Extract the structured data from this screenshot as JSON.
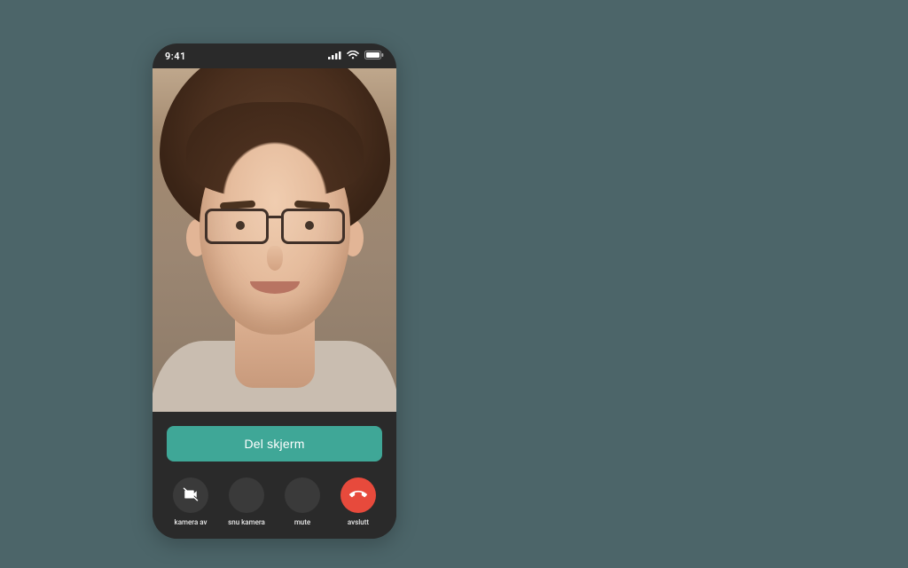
{
  "statusbar": {
    "time": "9:41"
  },
  "call": {
    "share_screen_label": "Del skjerm",
    "buttons": {
      "camera_off": "kamera av",
      "flip_camera": "snu kamera",
      "mute": "mute",
      "end_call": "avslutt"
    }
  },
  "colors": {
    "accent": "#3fa797",
    "danger": "#e74a3c",
    "phone_body": "#2a2a2a",
    "page_bg": "#4c6569"
  },
  "icons": {
    "signal": "signal-icon",
    "wifi": "wifi-icon",
    "battery": "battery-icon",
    "camera_off": "camera-off-icon",
    "flip_camera": "flip-camera-icon",
    "mute": "microphone-off-icon",
    "end_call": "phone-hangup-icon"
  }
}
